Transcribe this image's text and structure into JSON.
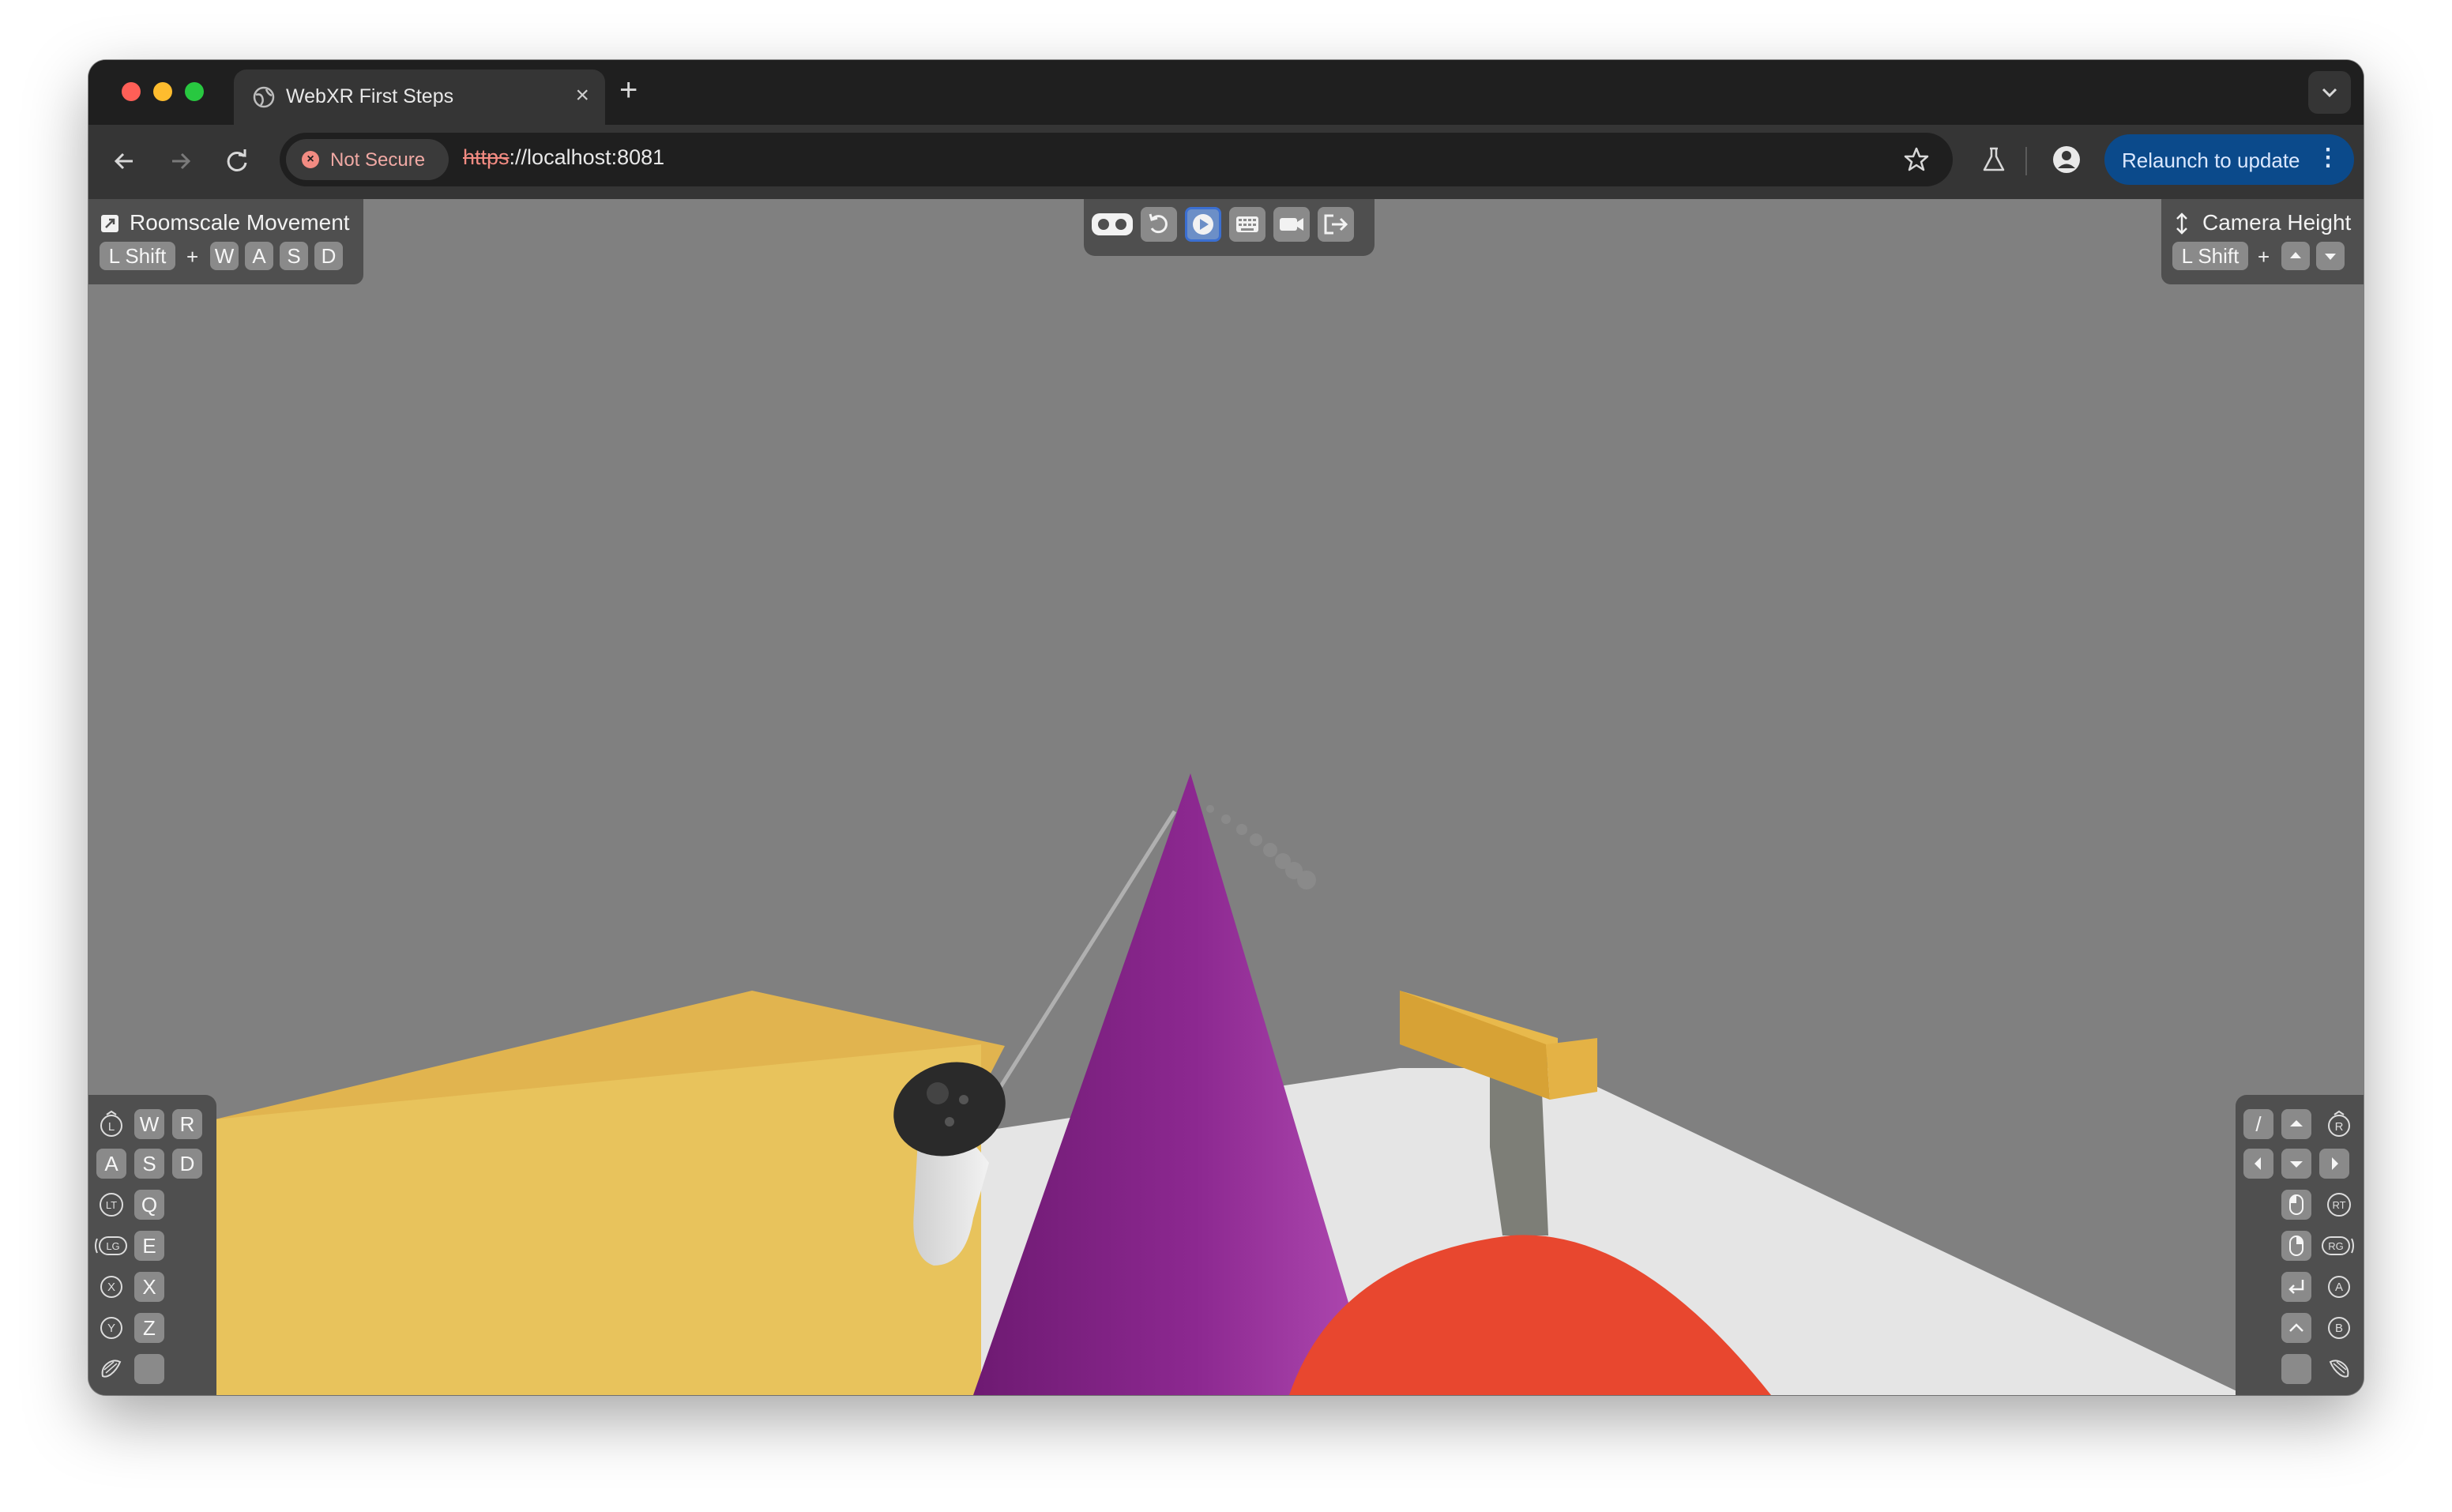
{
  "browser": {
    "tab_title": "WebXR First Steps",
    "tab_close": "×",
    "new_tab": "+",
    "security_label": "Not Secure",
    "url_scheme": "https",
    "url_rest": "://localhost:8081",
    "relaunch_label": "Relaunch to update",
    "relaunch_menu": "⋮"
  },
  "overlay": {
    "roomscale": {
      "title": "Roomscale Movement",
      "modifier": "L Shift",
      "plus": "+",
      "keys": [
        "W",
        "A",
        "S",
        "D"
      ]
    },
    "camera_height": {
      "title": "Camera Height",
      "modifier": "L Shift",
      "plus": "+"
    },
    "left_controller": {
      "rows": [
        {
          "icon": "L",
          "keys": [
            "W",
            "R"
          ]
        },
        {
          "icon": "",
          "keys": [
            "A",
            "S",
            "D"
          ]
        },
        {
          "icon": "LT",
          "keys": [
            "Q"
          ]
        },
        {
          "icon": "LG",
          "keys": [
            "E"
          ]
        },
        {
          "icon": "X",
          "keys": [
            "X"
          ]
        },
        {
          "icon": "Y",
          "keys": [
            "Z"
          ]
        },
        {
          "icon": "",
          "keys": [
            ""
          ]
        }
      ]
    },
    "right_controller": {
      "rows": [
        {
          "keys": [
            "/"
          ],
          "icon": "R"
        },
        {
          "keys": [],
          "icon": ""
        },
        {
          "keys": [],
          "icon": "RT"
        },
        {
          "keys": [],
          "icon": "RG"
        },
        {
          "keys": [],
          "icon": "A"
        },
        {
          "keys": [],
          "icon": "B"
        },
        {
          "keys": [
            ""
          ],
          "icon": ""
        }
      ]
    }
  },
  "colors": {
    "scene_bg": "#808080",
    "floor": "#e5e5e5",
    "yellow_box": "#e8c15a",
    "cone": "#9a2f9f",
    "sphere": "#e8472f",
    "accent": "#0b4a8b"
  }
}
